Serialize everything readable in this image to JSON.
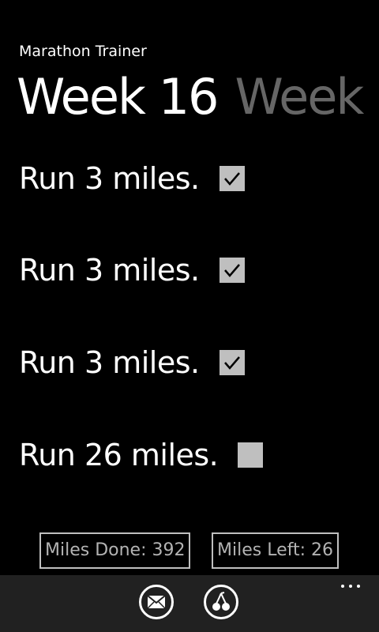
{
  "app": {
    "title": "Marathon Trainer"
  },
  "pivot": {
    "active_header": "Week 16",
    "next_header": "Week"
  },
  "tasks": [
    {
      "label": "Run 3 miles.",
      "checked": true
    },
    {
      "label": "Run 3 miles.",
      "checked": true
    },
    {
      "label": "Run 3 miles.",
      "checked": true
    },
    {
      "label": "Run 26 miles.",
      "checked": false
    }
  ],
  "stats": {
    "miles_done": "Miles Done: 392",
    "miles_left": "Miles Left: 26"
  },
  "app_bar": {
    "buttons": [
      {
        "icon": "mail-icon"
      },
      {
        "icon": "cherries-icon"
      }
    ],
    "more": "..."
  },
  "colors": {
    "background": "#000000",
    "foreground": "#ffffff",
    "inactive_header": "#666666",
    "checkbox": "#bfbfbf",
    "app_bar": "#212121"
  }
}
